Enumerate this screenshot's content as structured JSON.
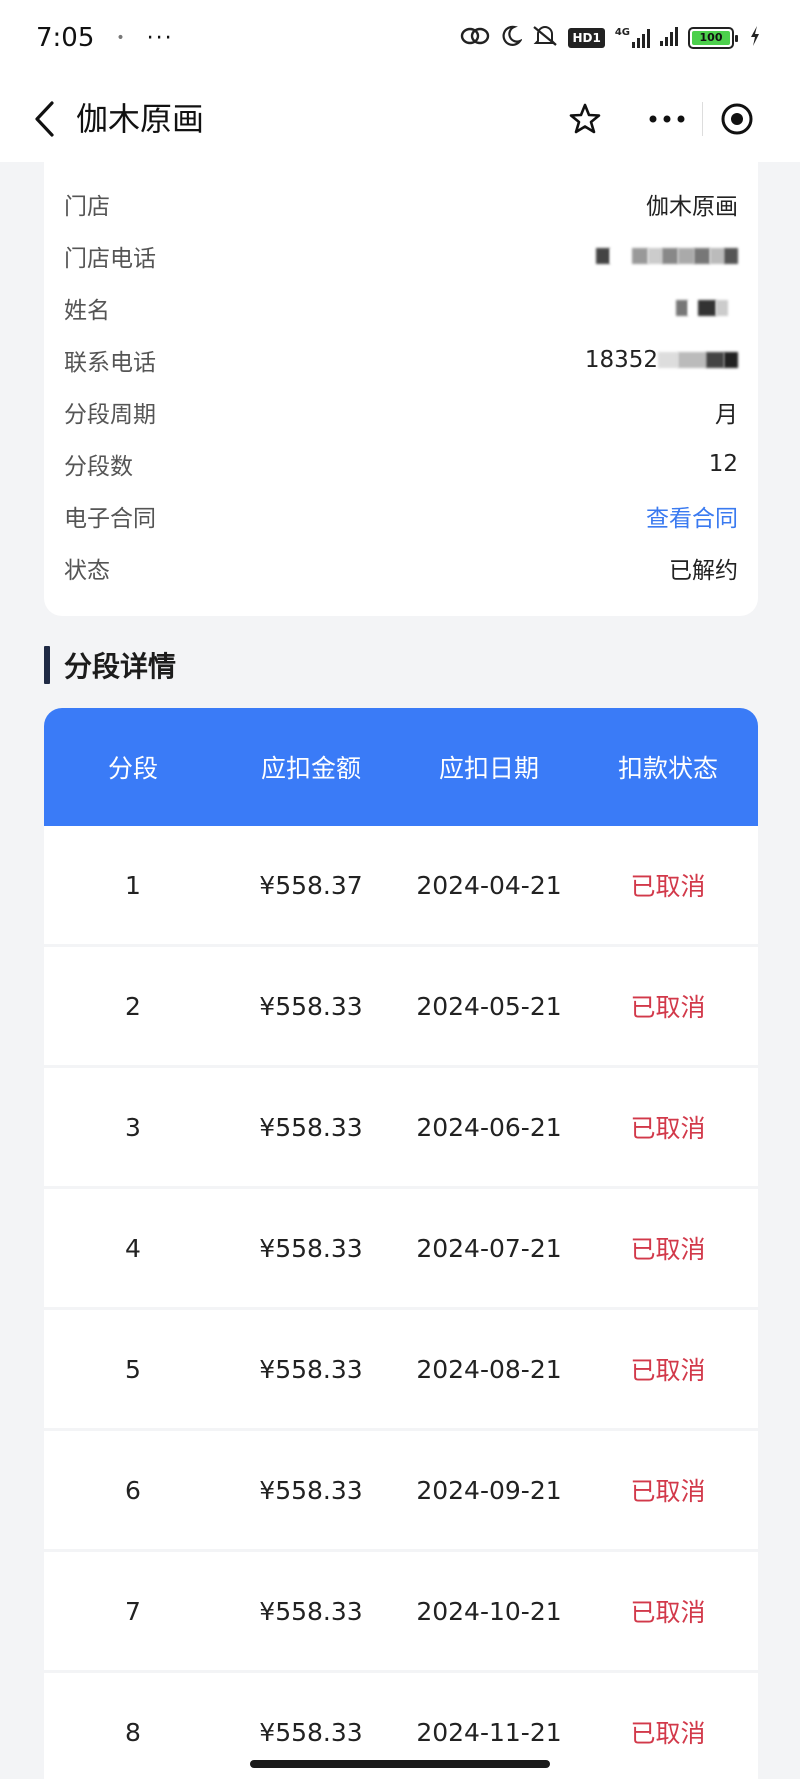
{
  "status_bar": {
    "time": "7:05",
    "notify_dot": "•",
    "more": "···",
    "hd_label": "HD1",
    "network_label": "4G",
    "battery": "100",
    "icons": [
      "link-icon",
      "moon-icon",
      "mute-icon",
      "hd-icon",
      "signal-icon",
      "signal-icon",
      "battery-icon",
      "charging-icon"
    ]
  },
  "nav": {
    "title": "伽木原画",
    "back_icon": "chevron-left-icon",
    "star_icon": "star-icon",
    "more_icon": "more-icon",
    "target_icon": "target-icon"
  },
  "info": {
    "rows": [
      {
        "label": "门店",
        "value": "伽木原画"
      },
      {
        "label": "门店电话",
        "value": ""
      },
      {
        "label": "姓名",
        "value": ""
      },
      {
        "label": "联系电话",
        "value": "18352"
      },
      {
        "label": "分段周期",
        "value": "月"
      },
      {
        "label": "分段数",
        "value": "12"
      },
      {
        "label": "电子合同",
        "value": "查看合同"
      },
      {
        "label": "状态",
        "value": "已解约"
      }
    ]
  },
  "section": {
    "title": "分段详情"
  },
  "table": {
    "headers": [
      "分段",
      "应扣金额",
      "应扣日期",
      "扣款状态"
    ],
    "rows": [
      [
        "1",
        "¥558.37",
        "2024-04-21",
        "已取消"
      ],
      [
        "2",
        "¥558.33",
        "2024-05-21",
        "已取消"
      ],
      [
        "3",
        "¥558.33",
        "2024-06-21",
        "已取消"
      ],
      [
        "4",
        "¥558.33",
        "2024-07-21",
        "已取消"
      ],
      [
        "5",
        "¥558.33",
        "2024-08-21",
        "已取消"
      ],
      [
        "6",
        "¥558.33",
        "2024-09-21",
        "已取消"
      ],
      [
        "7",
        "¥558.33",
        "2024-10-21",
        "已取消"
      ],
      [
        "8",
        "¥558.33",
        "2024-11-21",
        "已取消"
      ]
    ]
  },
  "colors": {
    "accent": "#3a7bf7",
    "link": "#3a7af0",
    "cancelled": "#d2394a"
  }
}
